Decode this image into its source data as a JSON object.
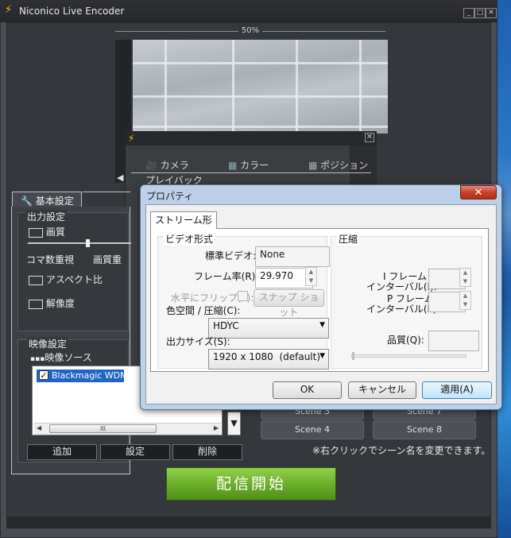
{
  "app": {
    "title": "Niconico Live Encoder",
    "zoom": "50%",
    "window_buttons": [
      "_",
      "□",
      "✕"
    ]
  },
  "camera_window": {
    "tabs": [
      "カメラ",
      "カラー",
      "ポジション"
    ],
    "playback": "プレイバック"
  },
  "basic_settings": {
    "tab_label": "基本設定",
    "output_group": "出力設定",
    "quality": "画質",
    "frame_priority": "コマ数重視",
    "quality_priority": "画質重",
    "aspect": "アスペクト比",
    "resolution": "解像度",
    "video_group": "映像設定",
    "video_source": "映像ソース",
    "source_items": [
      {
        "label": "Blackmagic WDM Ca",
        "checked": true
      }
    ],
    "scroll_label": "III",
    "buttons": {
      "add": "追加",
      "settings": "設定",
      "delete": "削除"
    }
  },
  "scenes": {
    "items": [
      "Scene 3",
      "Scene 7",
      "Scene 4",
      "Scene 8"
    ],
    "note": "※右クリックでシーン名を変更できます。"
  },
  "start_button": "配信開始",
  "properties": {
    "title": "プロパティ",
    "tab": "ストリーム形式",
    "video_format_group": "ビデオ形式",
    "standard_video_label": "標準ビデオ:",
    "standard_video_value": "None",
    "frame_rate_label": "フレーム率(R):",
    "frame_rate_value": "29.970",
    "flip_label": "水平にフリップ(F):",
    "snapshot_button": "スナップ ショット",
    "colorspace_label": "色空間 / 圧縮(C):",
    "colorspace_value": "HDYC",
    "output_size_label": "出力サイズ(S):",
    "output_size_value": "1920 x 1080  (default)",
    "compression_group": "圧縮",
    "iframe_label_1": "I フレーム",
    "iframe_label_2": "インターバル(I):",
    "pframe_label_1": "P フレーム",
    "pframe_label_2": "インターバル(P):",
    "quality_label": "品質(Q):",
    "ok": "OK",
    "cancel": "キャンセル",
    "apply": "適用(A)"
  }
}
